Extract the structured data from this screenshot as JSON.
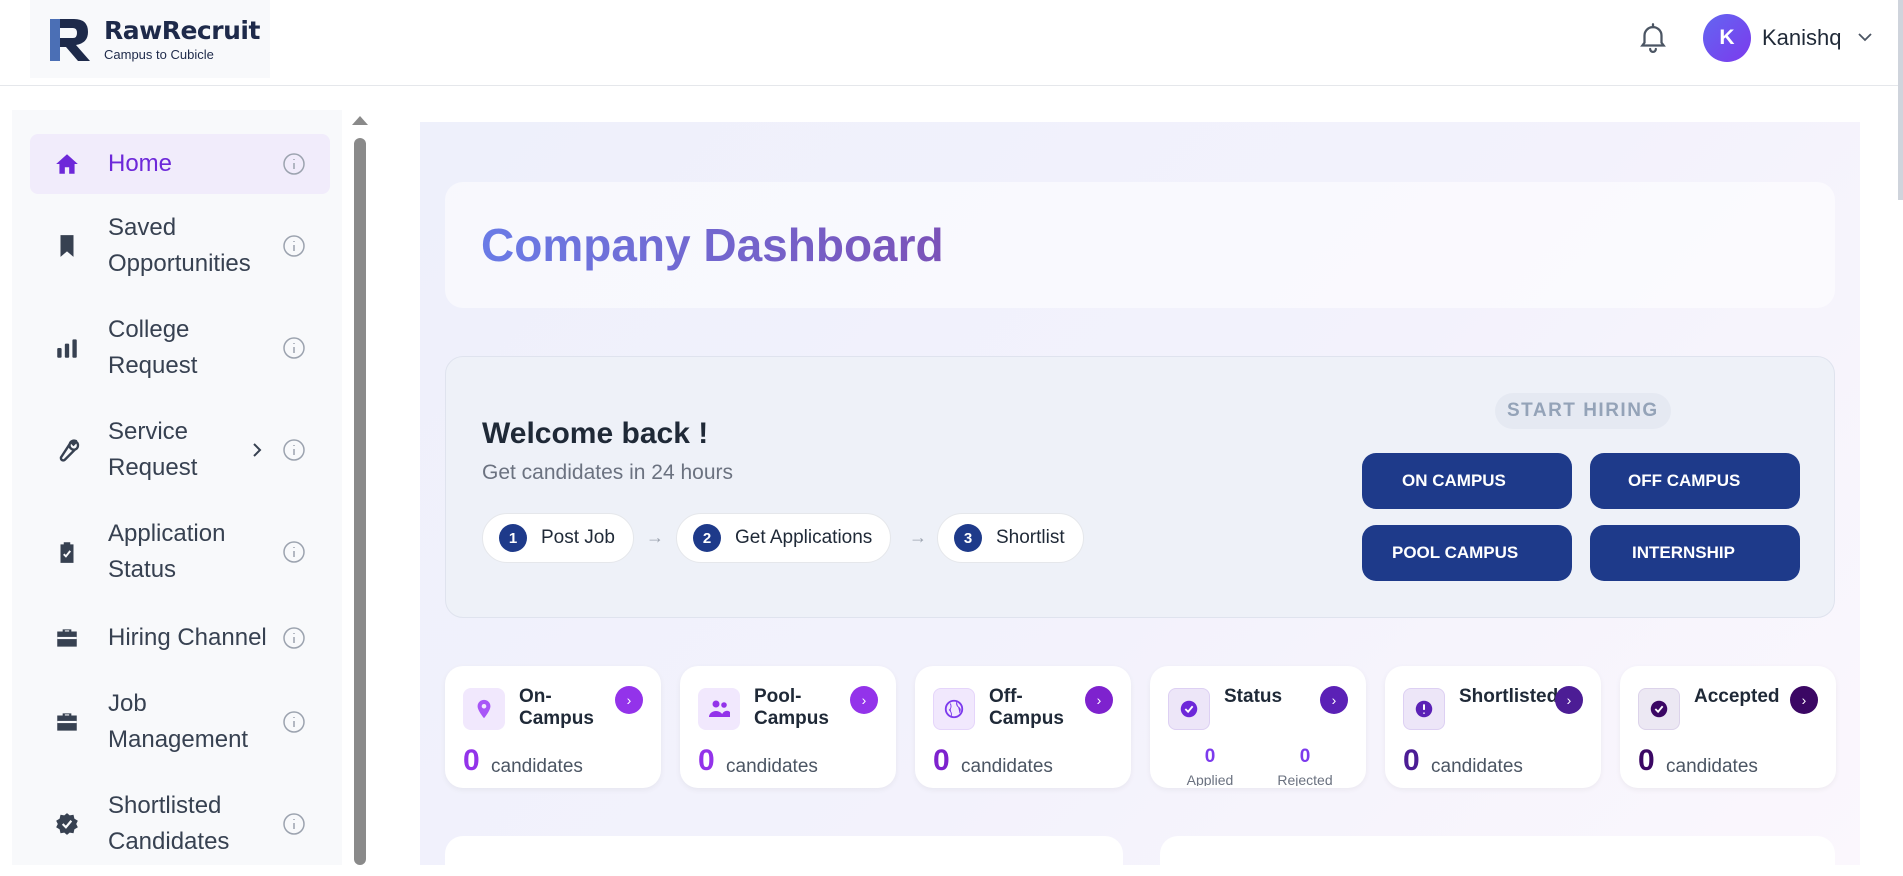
{
  "header": {
    "logo_name": "RawRecruit",
    "logo_tagline": "Campus to Cubicle",
    "user_initial": "K",
    "user_name": "Kanishq"
  },
  "sidebar": {
    "items": [
      {
        "label": "Home",
        "icon": "home-icon",
        "active": true
      },
      {
        "label": "Saved Opportunities",
        "icon": "bookmark-icon"
      },
      {
        "label": "College Request",
        "icon": "bar-chart-icon"
      },
      {
        "label": "Service Request",
        "icon": "wrench-icon",
        "has_submenu": true
      },
      {
        "label": "Application Status",
        "icon": "clipboard-icon"
      },
      {
        "label": "Hiring Channel",
        "icon": "briefcase-icon"
      },
      {
        "label": "Job Management",
        "icon": "briefcase-icon"
      },
      {
        "label": "Shortlisted Candidates",
        "icon": "badge-check-icon"
      }
    ]
  },
  "main": {
    "title": "Company Dashboard",
    "welcome": {
      "title": "Welcome back !",
      "subtitle": "Get candidates in 24 hours",
      "steps": [
        {
          "num": "1",
          "label": "Post Job"
        },
        {
          "num": "2",
          "label": "Get Applications"
        },
        {
          "num": "3",
          "label": "Shortlist"
        }
      ],
      "arrow": "→",
      "start_hiring": "START HIRING",
      "buttons": [
        "ON CAMPUS",
        "OFF CAMPUS",
        "POOL CAMPUS",
        "INTERNSHIP"
      ]
    },
    "stats": [
      {
        "title": "On-Campus",
        "value": "0",
        "unit": "candidates",
        "icon": "location-pin-icon"
      },
      {
        "title": "Pool-Campus",
        "value": "0",
        "unit": "candidates",
        "icon": "users-icon"
      },
      {
        "title": "Off-Campus",
        "value": "0",
        "unit": "candidates",
        "icon": "globe-icon"
      },
      {
        "title": "Status",
        "applied_value": "0",
        "applied_label": "Applied",
        "rejected_value": "0",
        "rejected_label": "Rejected",
        "icon": "check-circle-icon"
      },
      {
        "title": "Shortlisted",
        "value": "0",
        "unit": "candidates",
        "icon": "alert-circle-icon"
      },
      {
        "title": "Accepted",
        "value": "0",
        "unit": "candidates",
        "icon": "check-circle-icon"
      }
    ]
  },
  "colors": {
    "primary_blue": "#1e3a8a",
    "accent_purple": "#7c3aed",
    "dark_purple": "#4c1d95",
    "active_nav_bg": "#f1ecfb"
  }
}
